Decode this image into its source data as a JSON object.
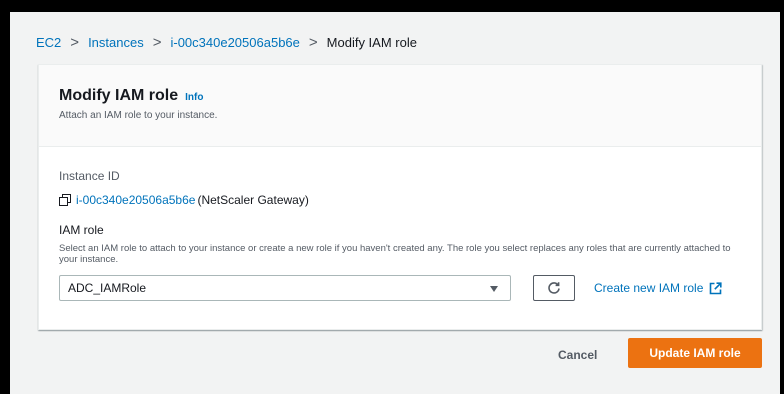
{
  "breadcrumb": {
    "items": [
      "EC2",
      "Instances",
      "i-00c340e20506a5b6e"
    ],
    "current": "Modify IAM role",
    "separator": ">"
  },
  "panel": {
    "title": "Modify IAM role",
    "info": "Info",
    "description": "Attach an IAM role to your instance."
  },
  "instance": {
    "label": "Instance ID",
    "id": "i-00c340e20506a5b6e",
    "name": "(NetScaler Gateway)",
    "icon": "copy-icon"
  },
  "iam_role": {
    "label": "IAM role",
    "description": "Select an IAM role to attach to your instance or create a new role if you haven't created any. The role you select replaces any roles that are currently attached to your instance.",
    "selected": "ADC_IAMRole",
    "refresh_icon": "refresh-icon",
    "create_link": "Create new IAM role",
    "external_icon": "external-link-icon"
  },
  "actions": {
    "cancel": "Cancel",
    "update": "Update IAM role"
  },
  "colors": {
    "link": "#0073bb",
    "primary_button": "#ec7211",
    "page_background": "#f2f3f3"
  }
}
